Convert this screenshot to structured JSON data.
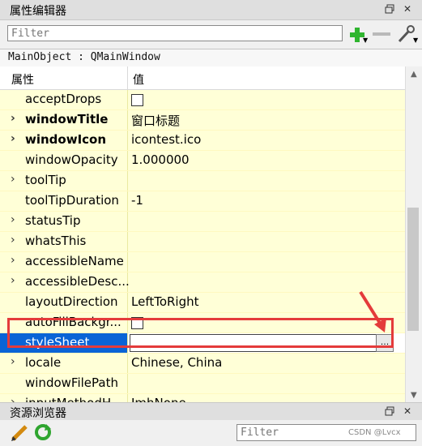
{
  "top_dock": {
    "title": "属性编辑器"
  },
  "filter": {
    "placeholder": "Filter"
  },
  "object_line": "MainObject : QMainWindow",
  "table": {
    "col_property": "属性",
    "col_value": "值",
    "rows": [
      {
        "name": "acceptDrops",
        "value": "",
        "checkbox": true,
        "expandable": false,
        "bold": false
      },
      {
        "name": "windowTitle",
        "value": "窗口标题",
        "checkbox": false,
        "expandable": true,
        "bold": true
      },
      {
        "name": "windowIcon",
        "value": "icontest.ico",
        "checkbox": false,
        "expandable": true,
        "bold": true
      },
      {
        "name": "windowOpacity",
        "value": "1.000000",
        "checkbox": false,
        "expandable": false,
        "bold": false
      },
      {
        "name": "toolTip",
        "value": "",
        "checkbox": false,
        "expandable": true,
        "bold": false
      },
      {
        "name": "toolTipDuration",
        "value": "-1",
        "checkbox": false,
        "expandable": false,
        "bold": false
      },
      {
        "name": "statusTip",
        "value": "",
        "checkbox": false,
        "expandable": true,
        "bold": false
      },
      {
        "name": "whatsThis",
        "value": "",
        "checkbox": false,
        "expandable": true,
        "bold": false
      },
      {
        "name": "accessibleName",
        "value": "",
        "checkbox": false,
        "expandable": true,
        "bold": false
      },
      {
        "name": "accessibleDesc...",
        "value": "",
        "checkbox": false,
        "expandable": true,
        "bold": false
      },
      {
        "name": "layoutDirection",
        "value": "LeftToRight",
        "checkbox": false,
        "expandable": false,
        "bold": false
      },
      {
        "name": "autoFillBackgr...",
        "value": "",
        "checkbox": true,
        "expandable": false,
        "bold": false
      },
      {
        "name": "styleSheet",
        "value": "",
        "checkbox": false,
        "expandable": false,
        "bold": false,
        "selected": true
      },
      {
        "name": "locale",
        "value": "Chinese, China",
        "checkbox": false,
        "expandable": true,
        "bold": false
      },
      {
        "name": "windowFilePath",
        "value": "",
        "checkbox": false,
        "expandable": false,
        "bold": false
      },
      {
        "name": "inputMethodH...",
        "value": "ImhNone",
        "checkbox": false,
        "expandable": true,
        "bold": false
      }
    ]
  },
  "edit_button_label": "...",
  "bottom_dock": {
    "title": "资源浏览器"
  },
  "bottom_filter": {
    "placeholder": "Filter"
  },
  "watermark": "CSDN @Lvcx",
  "colors": {
    "accent": "#0a64d6",
    "row_bg": "#ffffd7",
    "highlight": "#e43b3b"
  }
}
